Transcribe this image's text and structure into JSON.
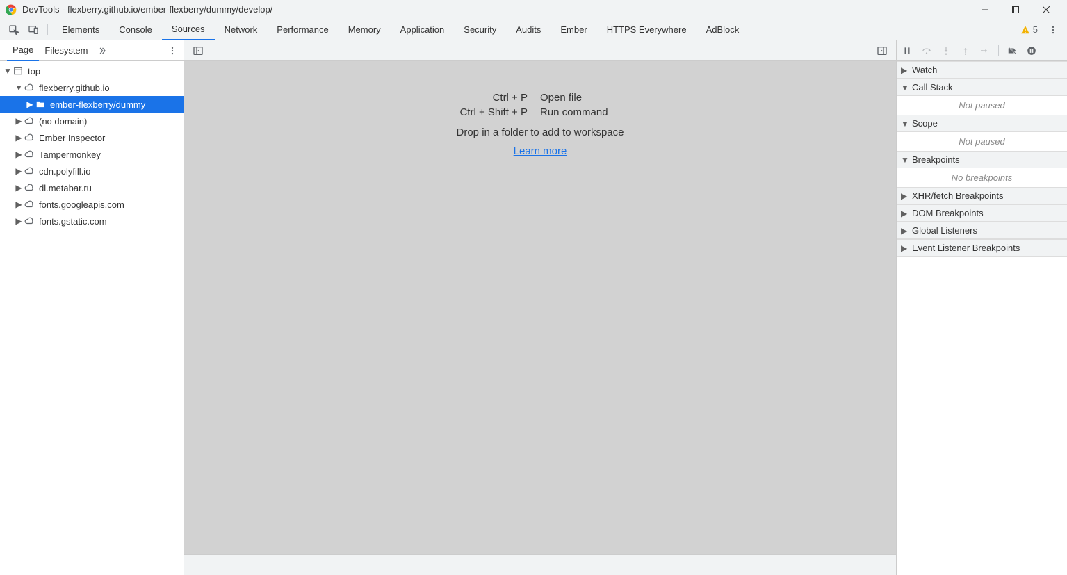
{
  "titlebar": {
    "title": "DevTools - flexberry.github.io/ember-flexberry/dummy/develop/"
  },
  "main_tabs": {
    "items": [
      "Elements",
      "Console",
      "Sources",
      "Network",
      "Performance",
      "Memory",
      "Application",
      "Security",
      "Audits",
      "Ember",
      "HTTPS Everywhere",
      "AdBlock"
    ],
    "active_index": 2,
    "warning_count": "5"
  },
  "left_panel": {
    "tabs": [
      "Page",
      "Filesystem"
    ],
    "active_index": 0,
    "tree": [
      {
        "indent": 0,
        "arrow": "down",
        "icon": "frame",
        "label": "top",
        "selected": false
      },
      {
        "indent": 1,
        "arrow": "down",
        "icon": "cloud",
        "label": "flexberry.github.io",
        "selected": false
      },
      {
        "indent": 2,
        "arrow": "right",
        "icon": "folder",
        "label": "ember-flexberry/dummy",
        "selected": true
      },
      {
        "indent": 1,
        "arrow": "right",
        "icon": "cloud",
        "label": "(no domain)",
        "selected": false
      },
      {
        "indent": 1,
        "arrow": "right",
        "icon": "cloud",
        "label": "Ember Inspector",
        "selected": false
      },
      {
        "indent": 1,
        "arrow": "right",
        "icon": "cloud",
        "label": "Tampermonkey",
        "selected": false
      },
      {
        "indent": 1,
        "arrow": "right",
        "icon": "cloud",
        "label": "cdn.polyfill.io",
        "selected": false
      },
      {
        "indent": 1,
        "arrow": "right",
        "icon": "cloud",
        "label": "dl.metabar.ru",
        "selected": false
      },
      {
        "indent": 1,
        "arrow": "right",
        "icon": "cloud",
        "label": "fonts.googleapis.com",
        "selected": false
      },
      {
        "indent": 1,
        "arrow": "right",
        "icon": "cloud",
        "label": "fonts.gstatic.com",
        "selected": false
      }
    ]
  },
  "editor": {
    "rows": [
      {
        "key": "Ctrl + P",
        "val": "Open file"
      },
      {
        "key": "Ctrl + Shift + P",
        "val": "Run command"
      }
    ],
    "drop_text": "Drop in a folder to add to workspace",
    "learn_more": "Learn more"
  },
  "right_panel": {
    "sections": [
      {
        "label": "Watch",
        "arrow": "right",
        "body": null
      },
      {
        "label": "Call Stack",
        "arrow": "down",
        "body": "Not paused"
      },
      {
        "label": "Scope",
        "arrow": "down",
        "body": "Not paused"
      },
      {
        "label": "Breakpoints",
        "arrow": "down",
        "body": "No breakpoints"
      },
      {
        "label": "XHR/fetch Breakpoints",
        "arrow": "right",
        "body": null
      },
      {
        "label": "DOM Breakpoints",
        "arrow": "right",
        "body": null
      },
      {
        "label": "Global Listeners",
        "arrow": "right",
        "body": null
      },
      {
        "label": "Event Listener Breakpoints",
        "arrow": "right",
        "body": null
      }
    ]
  }
}
